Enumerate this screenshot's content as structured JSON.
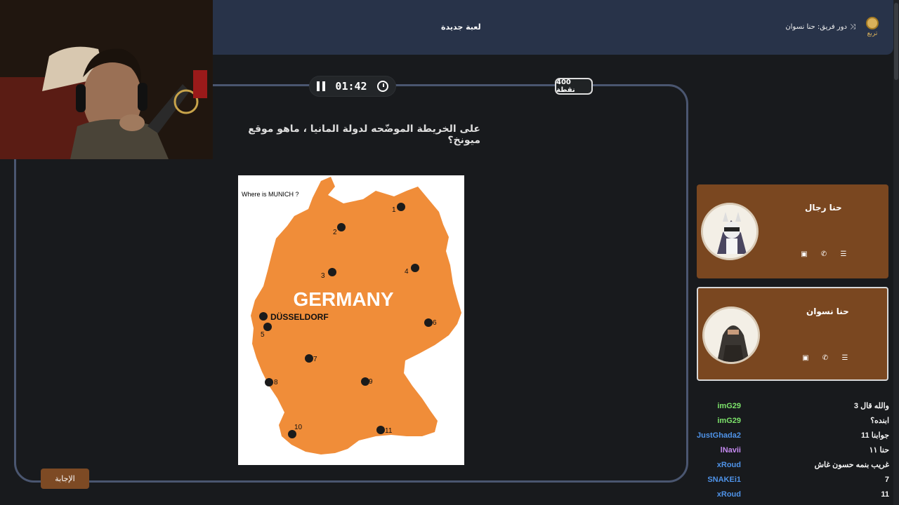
{
  "header": {
    "new_game": "لعبة جديدة",
    "turn_label": "دور فريق: حنا نسوان",
    "brand": "تربع"
  },
  "game": {
    "timer": "01:42",
    "points": "400 نقطة",
    "question": "على الخريطة الموضّحه لدولة المانيا ، ماهو موقع ميونخ؟",
    "answer_button": "الإجابة",
    "map": {
      "prompt": "Where is MUNICH ?",
      "country": "GERMANY",
      "city": "DÜSSELDORF",
      "markers": [
        "1",
        "2",
        "3",
        "4",
        "5",
        "6",
        "7",
        "8",
        "9",
        "10",
        "11"
      ]
    }
  },
  "teams": [
    {
      "name": "حنا رجال"
    },
    {
      "name": "حنا نسوان"
    }
  ],
  "chat": [
    {
      "user": "imG29",
      "message": "والله قال 3",
      "color": "#7de36b"
    },
    {
      "user": "imG29",
      "message": "ابنده؟",
      "color": "#7de36b"
    },
    {
      "user": "JustGhada2",
      "message": "جوابنا 11",
      "color": "#4f93e8"
    },
    {
      "user": "lNavii",
      "message": "حنا ١١",
      "color": "#c58af0"
    },
    {
      "user": "xRoud",
      "message": "غريب بنمه حسون غاش",
      "color": "#4f93e8"
    },
    {
      "user": "SNAKEi1",
      "message": "7",
      "color": "#4f93e8"
    },
    {
      "user": "xRoud",
      "message": "11",
      "color": "#4f93e8"
    }
  ],
  "colors": {
    "topbar": "#283349",
    "team_card": "#7a4720",
    "map_orange": "#f08d39",
    "accent_border": "#4a5670"
  }
}
